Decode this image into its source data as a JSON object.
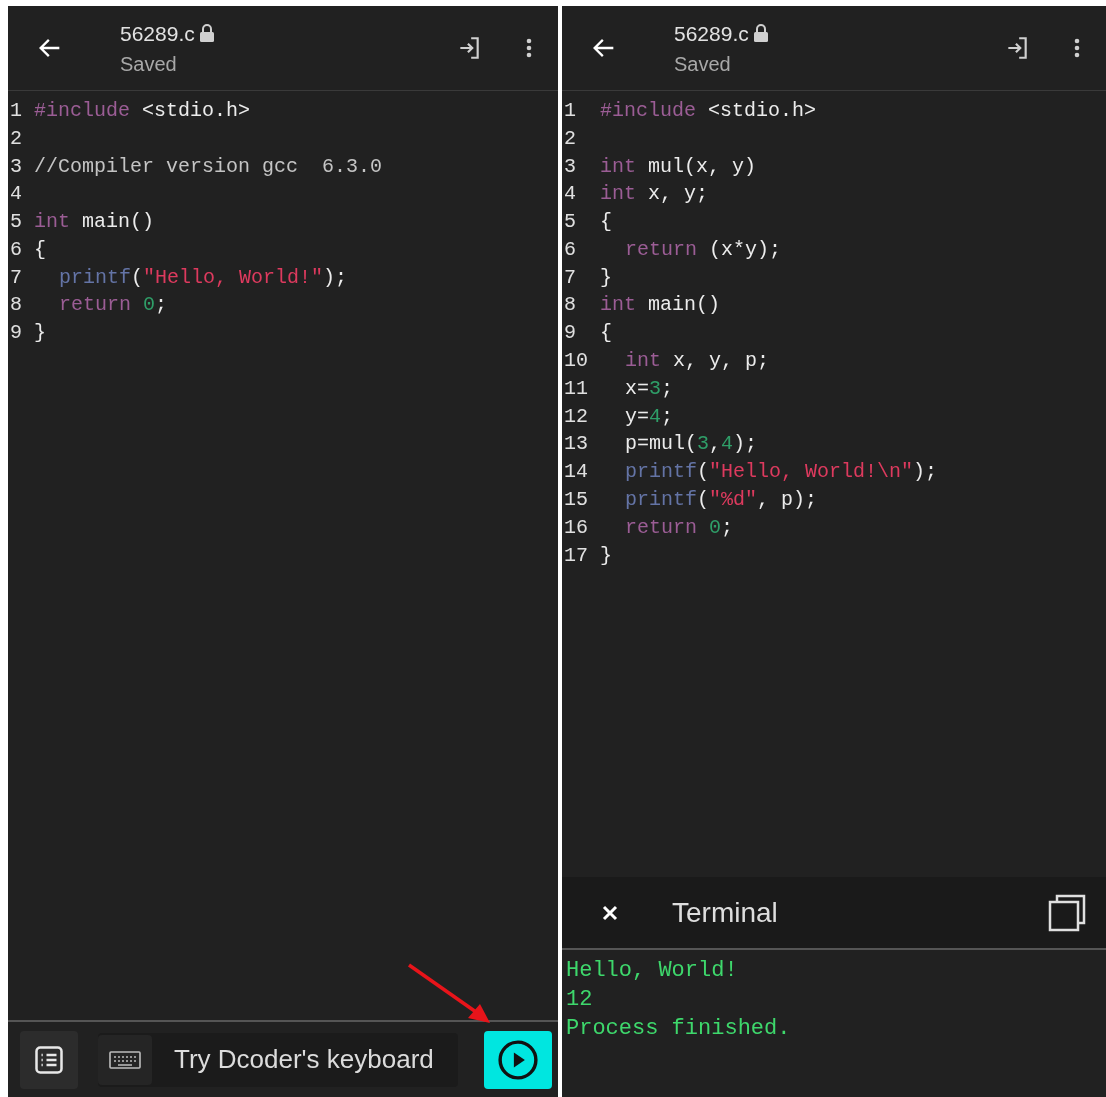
{
  "panels": [
    {
      "header": {
        "title": "56289.c",
        "status": "Saved"
      },
      "code": [
        {
          "n": "1",
          "indented": false,
          "tokens": [
            {
              "kind": "keyword",
              "text": "#include"
            },
            {
              "kind": "plain",
              "text": " <stdio.h>"
            }
          ]
        },
        {
          "n": "2"
        },
        {
          "n": "3",
          "indented": false,
          "tokens": [
            {
              "kind": "comment",
              "text": "//Compiler version gcc  6.3.0"
            }
          ]
        },
        {
          "n": "4"
        },
        {
          "n": "5",
          "indented": false,
          "tokens": [
            {
              "kind": "keyword",
              "text": "int"
            },
            {
              "kind": "plain",
              "text": " main()"
            }
          ]
        },
        {
          "n": "6",
          "indented": false,
          "tokens": [
            {
              "kind": "plain",
              "text": "{"
            }
          ]
        },
        {
          "n": "7",
          "indented": true,
          "tokens": [
            {
              "kind": "function",
              "text": "printf"
            },
            {
              "kind": "plain",
              "text": "("
            },
            {
              "kind": "string",
              "text": "\"Hello, World!\""
            },
            {
              "kind": "plain",
              "text": ");"
            }
          ]
        },
        {
          "n": "8",
          "indented": true,
          "tokens": [
            {
              "kind": "keyword",
              "text": "return"
            },
            {
              "kind": "number",
              "text": " 0"
            },
            {
              "kind": "plain",
              "text": ";"
            }
          ]
        },
        {
          "n": "9",
          "indented": false,
          "tokens": [
            {
              "kind": "plain",
              "text": "}"
            }
          ]
        }
      ],
      "bottom_bar": {
        "keyboard_hint": "Try Dcoder's keyboard"
      }
    },
    {
      "header": {
        "title": "56289.c",
        "status": "Saved"
      },
      "code": [
        {
          "n": "1",
          "indented": false,
          "tokens": [
            {
              "kind": "keyword",
              "text": "#include"
            },
            {
              "kind": "plain",
              "text": " <stdio.h>"
            }
          ]
        },
        {
          "n": "2"
        },
        {
          "n": "3",
          "indented": false,
          "tokens": [
            {
              "kind": "keyword",
              "text": "int"
            },
            {
              "kind": "plain",
              "text": " mul(x, y)"
            }
          ]
        },
        {
          "n": "4",
          "indented": false,
          "tokens": [
            {
              "kind": "keyword",
              "text": "int"
            },
            {
              "kind": "plain",
              "text": " x, y;"
            }
          ]
        },
        {
          "n": "5",
          "indented": false,
          "tokens": [
            {
              "kind": "plain",
              "text": "{"
            }
          ]
        },
        {
          "n": "6",
          "indented": true,
          "tokens": [
            {
              "kind": "keyword",
              "text": "return"
            },
            {
              "kind": "plain",
              "text": " (x*y);"
            }
          ]
        },
        {
          "n": "7",
          "indented": false,
          "tokens": [
            {
              "kind": "plain",
              "text": "}"
            }
          ]
        },
        {
          "n": "8",
          "indented": false,
          "tokens": [
            {
              "kind": "keyword",
              "text": "int"
            },
            {
              "kind": "plain",
              "text": " main()"
            }
          ]
        },
        {
          "n": "9",
          "indented": false,
          "tokens": [
            {
              "kind": "plain",
              "text": "{"
            }
          ]
        },
        {
          "n": "10",
          "indented": true,
          "tokens": [
            {
              "kind": "keyword",
              "text": "int"
            },
            {
              "kind": "plain",
              "text": " x, y, p;"
            }
          ]
        },
        {
          "n": "11",
          "indented": true,
          "tokens": [
            {
              "kind": "plain",
              "text": "x="
            },
            {
              "kind": "number",
              "text": "3"
            },
            {
              "kind": "plain",
              "text": ";"
            }
          ]
        },
        {
          "n": "12",
          "indented": true,
          "tokens": [
            {
              "kind": "plain",
              "text": "y="
            },
            {
              "kind": "number",
              "text": "4"
            },
            {
              "kind": "plain",
              "text": ";"
            }
          ]
        },
        {
          "n": "13",
          "indented": true,
          "tokens": [
            {
              "kind": "plain",
              "text": "p=mul("
            },
            {
              "kind": "number",
              "text": "3"
            },
            {
              "kind": "plain",
              "text": ","
            },
            {
              "kind": "number",
              "text": "4"
            },
            {
              "kind": "plain",
              "text": ");"
            }
          ]
        },
        {
          "n": "14",
          "indented": true,
          "tokens": [
            {
              "kind": "function",
              "text": "printf"
            },
            {
              "kind": "plain",
              "text": "("
            },
            {
              "kind": "string",
              "text": "\"Hello, World!\\n\""
            },
            {
              "kind": "plain",
              "text": ");"
            }
          ]
        },
        {
          "n": "15",
          "indented": true,
          "tokens": [
            {
              "kind": "function",
              "text": "printf"
            },
            {
              "kind": "plain",
              "text": "("
            },
            {
              "kind": "string",
              "text": "\"%d\""
            },
            {
              "kind": "plain",
              "text": ", p);"
            }
          ]
        },
        {
          "n": "16",
          "indented": true,
          "tokens": [
            {
              "kind": "keyword",
              "text": "return"
            },
            {
              "kind": "number",
              "text": " 0"
            },
            {
              "kind": "plain",
              "text": ";"
            }
          ]
        },
        {
          "n": "17",
          "indented": false,
          "tokens": [
            {
              "kind": "plain",
              "text": "}"
            }
          ]
        }
      ],
      "terminal": {
        "title": "Terminal",
        "output": [
          "Hello, World!",
          "12",
          "Process finished."
        ]
      }
    }
  ]
}
